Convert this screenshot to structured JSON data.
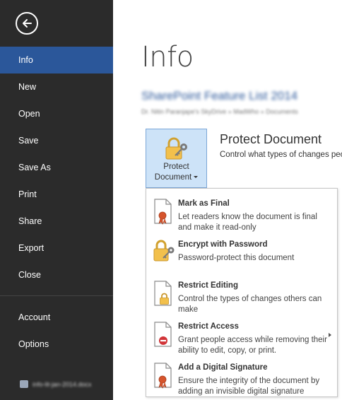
{
  "sidebar": {
    "items": [
      {
        "label": "Info"
      },
      {
        "label": "New"
      },
      {
        "label": "Open"
      },
      {
        "label": "Save"
      },
      {
        "label": "Save As"
      },
      {
        "label": "Print"
      },
      {
        "label": "Share"
      },
      {
        "label": "Export"
      },
      {
        "label": "Close"
      },
      {
        "label": "Account"
      },
      {
        "label": "Options"
      }
    ],
    "active_index": 0,
    "user_blurred": "info-lit-jan-2014.docx"
  },
  "main": {
    "title": "Info",
    "doc_title_blurred": "SharePoint Feature List 2014",
    "doc_path_blurred": "Dr. Nitin Paranjape's SkyDrive » MadWho » Documents",
    "protect": {
      "button_line1": "Protect",
      "button_line2": "Document",
      "heading": "Protect Document",
      "description": "Control what types of changes people can make to this document."
    },
    "menu": [
      {
        "title": "Mark as Final",
        "desc": "Let readers know the document is final and make it read-only"
      },
      {
        "title": "Encrypt with Password",
        "desc": "Password-protect this document"
      },
      {
        "title": "Restrict Editing",
        "desc": "Control the types of changes others can make"
      },
      {
        "title": "Restrict Access",
        "desc": "Grant people access while removing their ability to edit, copy, or print."
      },
      {
        "title": "Add a Digital Signature",
        "desc": "Ensure the integrity of the document by adding an invisible digital signature"
      }
    ]
  },
  "colors": {
    "sidebar_bg": "#2b2b2b",
    "accent": "#2b579a",
    "button_highlight": "#cde3f8"
  },
  "icons": [
    "back-arrow-icon",
    "lock-key-icon",
    "ribbon-document-icon",
    "lock-document-icon",
    "no-entry-document-icon"
  ]
}
